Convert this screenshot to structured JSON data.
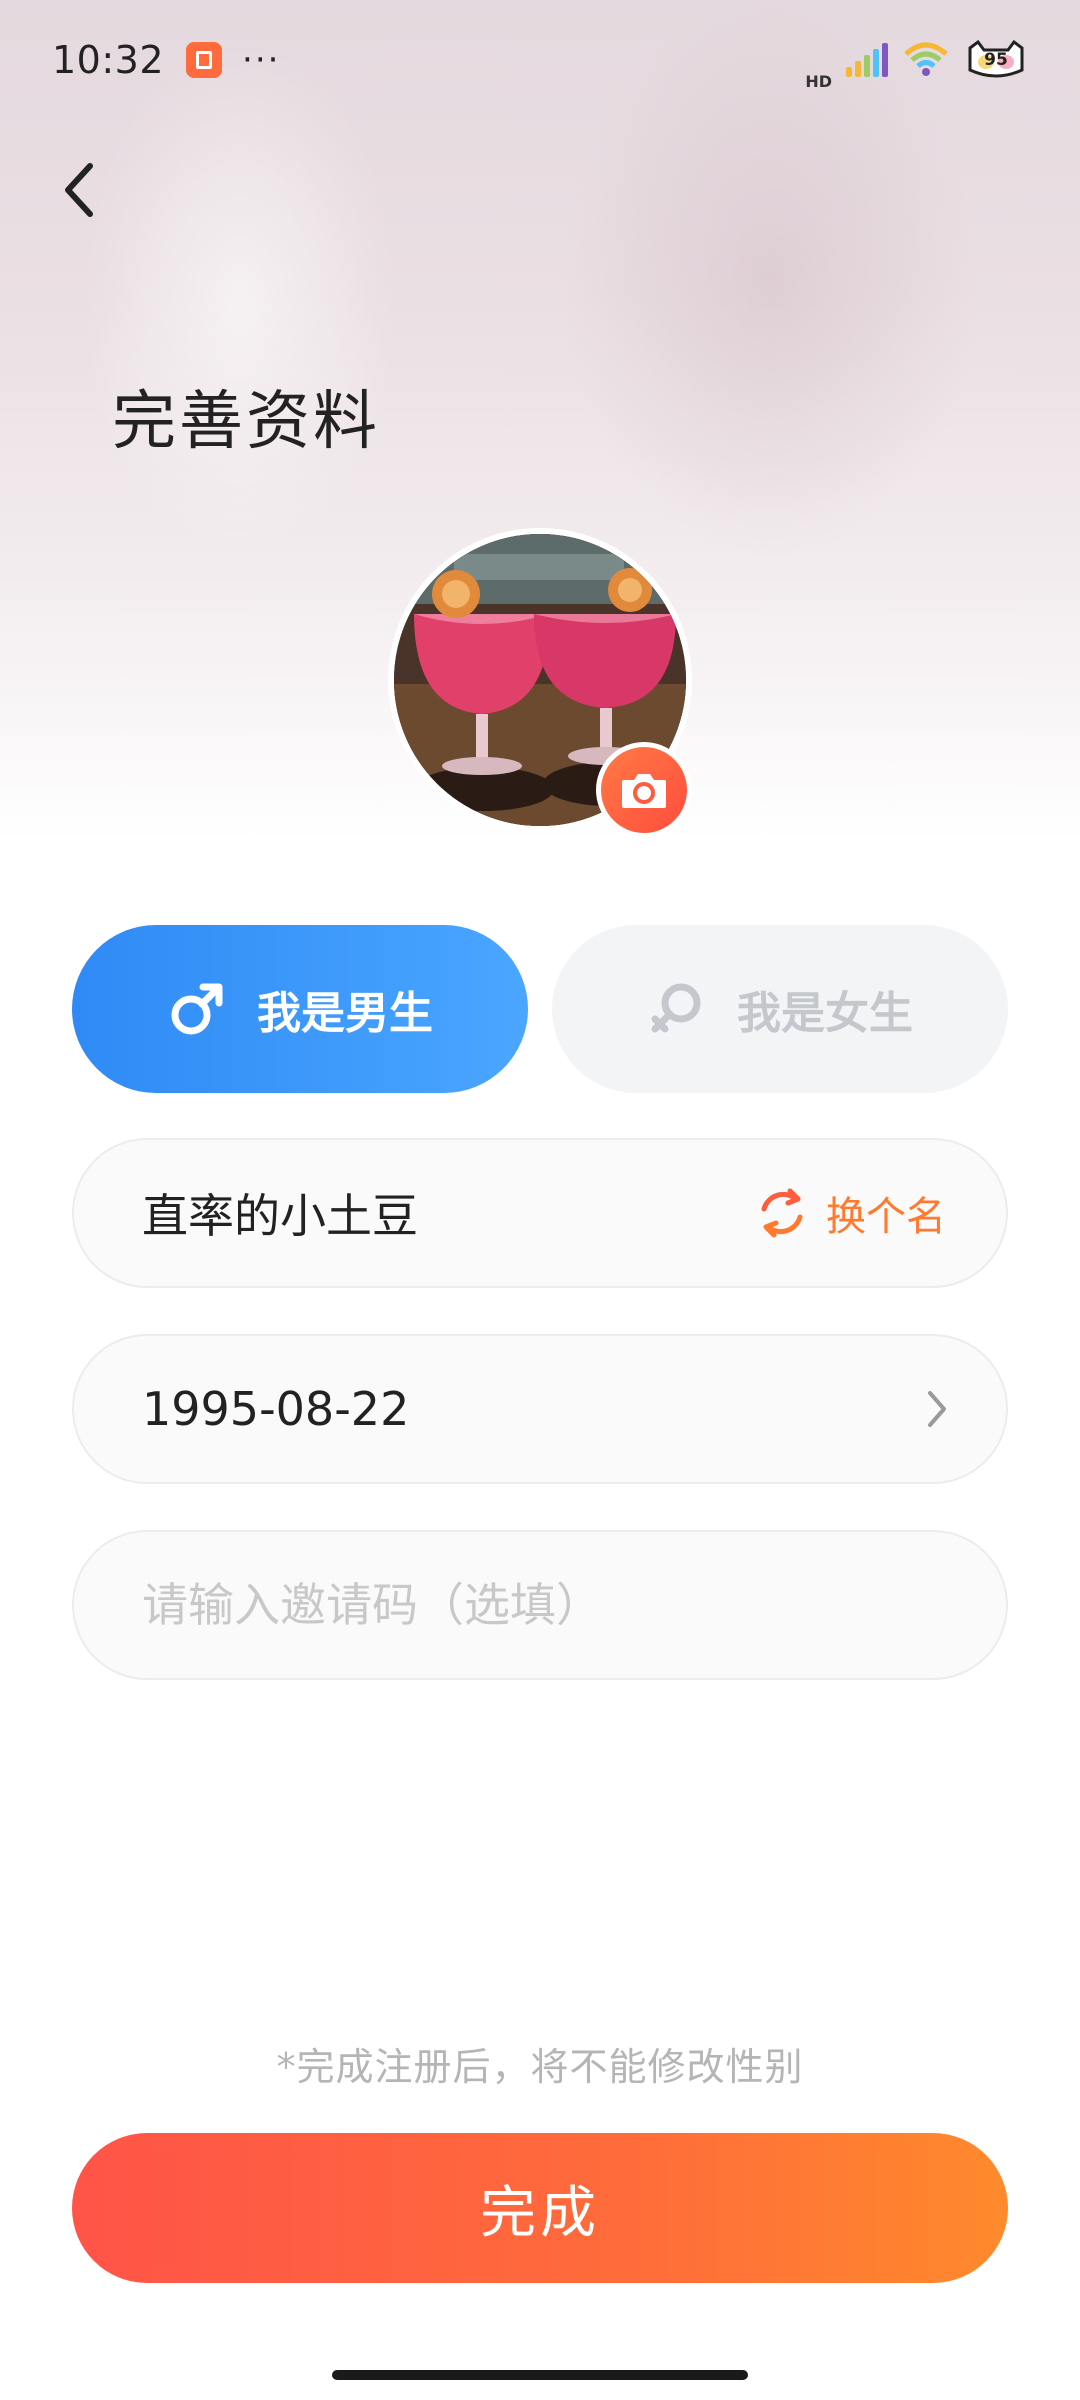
{
  "status_bar": {
    "time": "10:32",
    "dots": "···",
    "network": "HD",
    "battery_level": "95"
  },
  "header": {
    "title": "完善资料"
  },
  "gender": {
    "male_label": "我是男生",
    "female_label": "我是女生",
    "selected": "male"
  },
  "form": {
    "nickname": "直率的小土豆",
    "rename_label": "换个名",
    "birthday": "1995-08-22",
    "invite_placeholder": "请输入邀请码（选填）",
    "invite_value": ""
  },
  "note": "*完成注册后，将不能修改性别",
  "submit_label": "完成",
  "colors": {
    "male_gradient_start": "#2f8af5",
    "male_gradient_end": "#4aa6ff",
    "accent_orange": "#ff7a2e",
    "submit_gradient_start": "#ff5448",
    "submit_gradient_end": "#ff8a2c"
  },
  "icons": {
    "back": "chevron-left-icon",
    "camera": "camera-icon",
    "male": "male-symbol-icon",
    "female": "female-symbol-icon",
    "refresh": "refresh-icon",
    "chevron": "chevron-right-icon"
  }
}
